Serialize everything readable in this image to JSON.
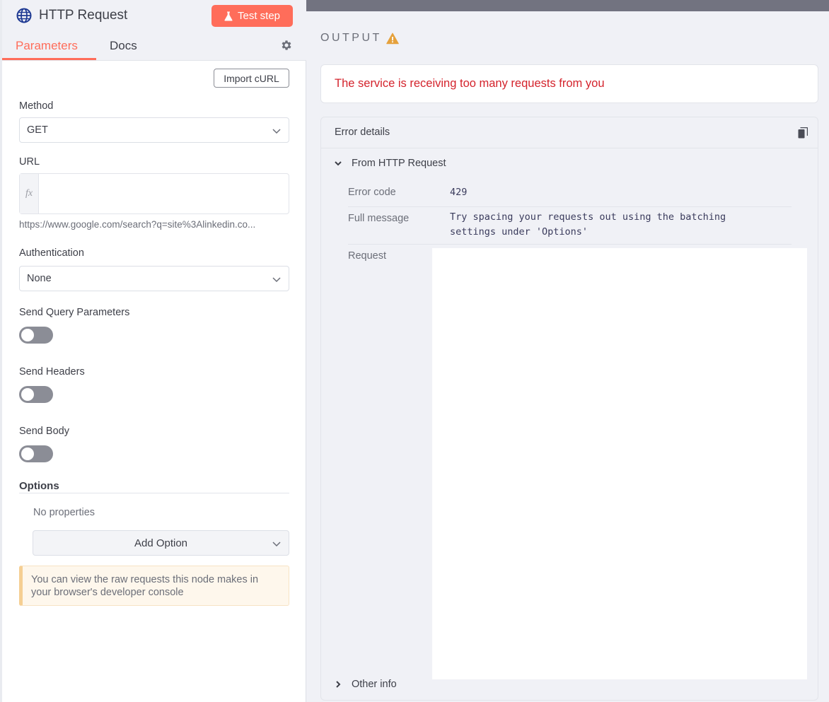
{
  "node": {
    "title": "HTTP Request",
    "test_step_label": "Test step"
  },
  "tabs": [
    {
      "label": "Parameters",
      "active": true
    },
    {
      "label": "Docs",
      "active": false
    }
  ],
  "params": {
    "import_curl_label": "Import cURL",
    "method_label": "Method",
    "method_value": "GET",
    "url_label": "URL",
    "url_fx": "fx",
    "url_value": "",
    "url_hint": "https://www.google.com/search?q=site%3Alinkedin.co...",
    "auth_label": "Authentication",
    "auth_value": "None",
    "send_query_label": "Send Query Parameters",
    "send_query_on": false,
    "send_headers_label": "Send Headers",
    "send_headers_on": false,
    "send_body_label": "Send Body",
    "send_body_on": false,
    "options_label": "Options",
    "no_properties": "No properties",
    "add_option_label": "Add Option",
    "notice": "You can view the raw requests this node makes in your browser's developer console"
  },
  "output": {
    "label": "OUTPUT",
    "error_message": "The service is receiving too many requests from you",
    "details_title": "Error details",
    "from_section": "From HTTP Request",
    "error_code_key": "Error code",
    "error_code_value": "429",
    "full_message_key": "Full message",
    "full_message_line1": "Try spacing your requests out using the batching",
    "full_message_line2": "settings under 'Options'",
    "request_key": "Request",
    "other_info": "Other info"
  },
  "colors": {
    "accent": "#ff6d5a",
    "error": "#d4232c",
    "warning": "#e5a13c",
    "toggle_off": "#8b8d96"
  }
}
